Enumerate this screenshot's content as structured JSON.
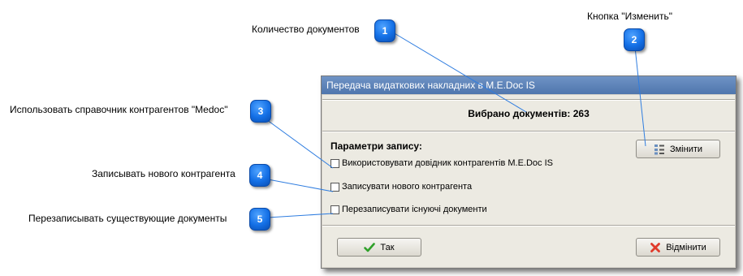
{
  "callouts": [
    {
      "num": "1",
      "label": "Количество документов"
    },
    {
      "num": "2",
      "label": "Кнопка \"Изменить\""
    },
    {
      "num": "3",
      "label": "Использовать справочник контрагентов \"Medoc\""
    },
    {
      "num": "4",
      "label": "Записывать нового контрагента"
    },
    {
      "num": "5",
      "label": "Перезаписывать существующие документы"
    }
  ],
  "dialog": {
    "title": "Передача видаткових накладних в M.E.Doc IS",
    "selected_text": "Вибрано документів: 263",
    "params_title": "Параметри запису:",
    "change_button": "Змінити",
    "options": [
      {
        "label": "Використовувати довідник контрагентів M.E.Doc IS",
        "checked": false
      },
      {
        "label": "Записувати нового контрагента",
        "checked": false
      },
      {
        "label": "Перезаписувати існуючі документи",
        "checked": false
      }
    ],
    "ok_button": "Так",
    "cancel_button": "Відмінити"
  }
}
